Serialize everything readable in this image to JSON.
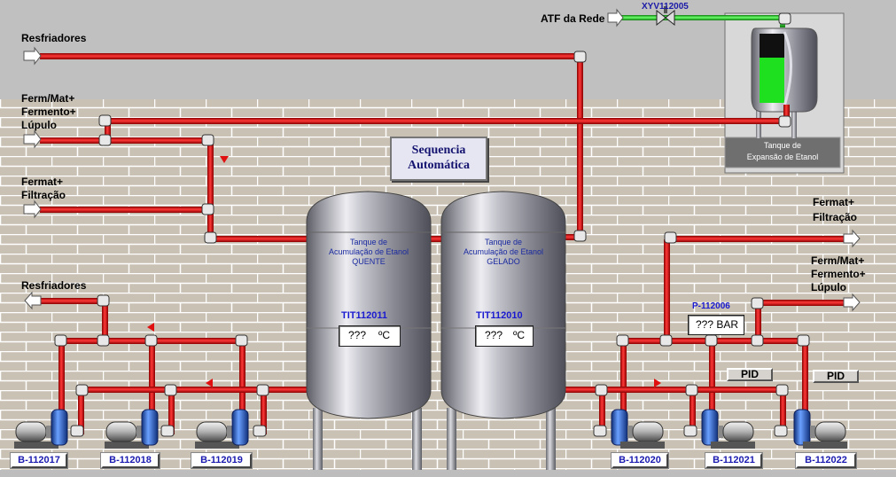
{
  "colors": {
    "pipe_red": "#d21414",
    "pipe_green": "#2bcc2b",
    "brick": "#c9c1b3",
    "mortar": "#ffffff",
    "sky": "#c0c0c0",
    "level_green": "#1fe01f",
    "tag_blue": "#1a1ad0"
  },
  "header": {
    "atf_source": "ATF da Rede",
    "valve_tag": "XYV112005"
  },
  "flows": {
    "resfriadores_top": "Resfriadores",
    "ferm_left_1": "Ferm/Mat+",
    "ferm_left_2": "Fermento+",
    "ferm_left_3": "Lúpulo",
    "filt_left_1": "Fermat+",
    "filt_left_2": "Filtração",
    "resfriadores_bottom": "Resfriadores",
    "filt_right_1": "Fermat+",
    "filt_right_2": "Filtração",
    "ferm_right_1": "Ferm/Mat+",
    "ferm_right_2": "Fermento+",
    "ferm_right_3": "Lúpulo"
  },
  "sequence_button": {
    "line1": "Sequencia",
    "line2": "Automática"
  },
  "expansion_tank": {
    "line1": "Tanque de",
    "line2": "Expansão de Etanol",
    "level_fraction": 0.65
  },
  "tanks": [
    {
      "name_1": "Tanque de",
      "name_2": "Acumulação de Etanol",
      "name_3": "QUENTE",
      "tag": "TIT112011",
      "value": "???",
      "unit": "ºC"
    },
    {
      "name_1": "Tanque de",
      "name_2": "Acumulação de Etanol",
      "name_3": "GELADO",
      "tag": "TIT112010",
      "value": "???",
      "unit": "ºC"
    }
  ],
  "pressure": {
    "tag": "P-112006",
    "value": "??? BAR"
  },
  "pid_buttons": [
    "PID",
    "PID"
  ],
  "pumps": [
    "B-112017",
    "B-112018",
    "B-112019",
    "B-112020",
    "B-112021",
    "B-112022"
  ]
}
